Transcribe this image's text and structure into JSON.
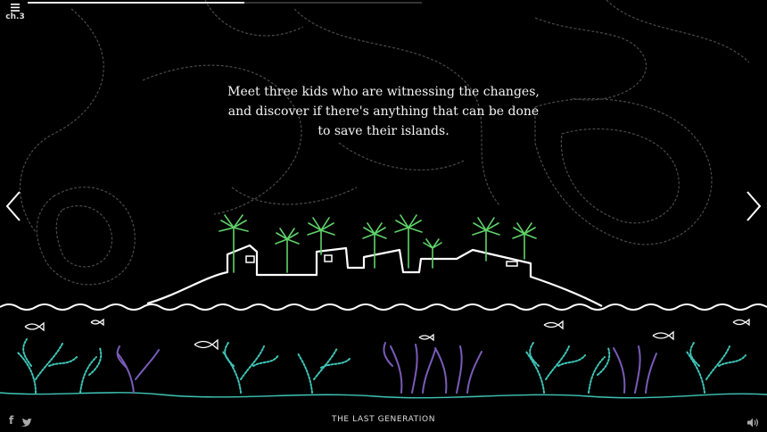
{
  "header": {
    "chapter": "ch.3",
    "progress": 0.55
  },
  "story": {
    "lines": [
      "Meet three kids who are witnessing the changes,",
      "and discover if there's anything that can be done",
      "to save their islands."
    ]
  },
  "footer": {
    "title": "THE LAST GENERATION"
  },
  "icons": {
    "menu": "hamburger-icon",
    "prev": "chevron-left-icon",
    "next": "chevron-right-icon",
    "facebook": "facebook-icon",
    "twitter": "twitter-icon",
    "sound": "speaker-icon"
  },
  "colors": {
    "background": "#000000",
    "line": "#ffffff",
    "palm": "#5fd36a",
    "coral_teal": "#3fc6b8",
    "coral_purple": "#7a5bb8",
    "contour": "#4a4a4a"
  }
}
